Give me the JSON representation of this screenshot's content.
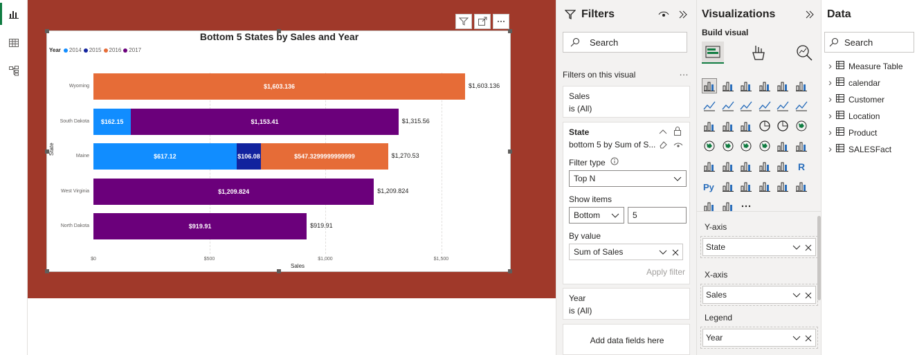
{
  "rail": {
    "items": [
      "report-view",
      "table-view",
      "model-view"
    ]
  },
  "chart": {
    "title": "Bottom 5 States by Sales and Year",
    "legend_title": "Year",
    "ylabel": "State",
    "xlabel": "Sales"
  },
  "chart_data": {
    "type": "bar",
    "orientation": "horizontal",
    "stacked": true,
    "title": "Bottom 5 States by Sales and Year",
    "xlabel": "Sales",
    "ylabel": "State",
    "xlim": [
      0,
      1600
    ],
    "x_ticks": [
      "$0",
      "$500",
      "$1,000",
      "$1,500"
    ],
    "categories": [
      "Wyoming",
      "South Dakota",
      "Maine",
      "West Virginia",
      "North Dakota"
    ],
    "series": [
      {
        "name": "2014",
        "color": "#118dff",
        "values": [
          0,
          162.15,
          617.12,
          0,
          0
        ],
        "labels": [
          "",
          "$162.15",
          "$617.12",
          "",
          ""
        ]
      },
      {
        "name": "2015",
        "color": "#12239e",
        "values": [
          0,
          0,
          106.08,
          0,
          0
        ],
        "labels": [
          "",
          "",
          "$106.08",
          "",
          ""
        ]
      },
      {
        "name": "2016",
        "color": "#e66c37",
        "values": [
          1603.136,
          0,
          547.33,
          0,
          0
        ],
        "labels": [
          "$1,603.136",
          "",
          "$547.3299999999999",
          "",
          ""
        ]
      },
      {
        "name": "2017",
        "color": "#6b007b",
        "values": [
          0,
          1153.41,
          0,
          1209.824,
          919.91
        ],
        "labels": [
          "",
          "$1,153.41",
          "",
          "$1,209.824",
          "$919.91"
        ]
      }
    ],
    "totals": [
      "$1,603.136",
      "$1,315.56",
      "$1,270.53",
      "$1,209.824",
      "$919.91"
    ],
    "grid": true,
    "legend_position": "top-left"
  },
  "filters": {
    "title": "Filters",
    "search_placeholder": "Search",
    "section_label": "Filters on this visual",
    "sales_card": {
      "title": "Sales",
      "value": "is (All)"
    },
    "state_card": {
      "title": "State",
      "summary": "bottom 5 by Sum of S...",
      "filter_type_label": "Filter type",
      "filter_type_value": "Top N",
      "show_items_label": "Show items",
      "show_items_dir": "Bottom",
      "show_items_count": "5",
      "by_value_label": "By value",
      "by_value_field": "Sum of Sales",
      "apply_label": "Apply filter"
    },
    "year_card": {
      "title": "Year",
      "value": "is (All)"
    },
    "add_fields_label": "Add data fields here"
  },
  "viz": {
    "title": "Visualizations",
    "build_label": "Build visual",
    "wells": [
      {
        "label": "Y-axis",
        "field": "State"
      },
      {
        "label": "X-axis",
        "field": "Sales"
      },
      {
        "label": "Legend",
        "field": "Year"
      }
    ]
  },
  "data": {
    "title": "Data",
    "search_placeholder": "Search",
    "tables": [
      "Measure Table",
      "calendar",
      "Customer",
      "Location",
      "Product",
      "SALESFact"
    ]
  }
}
